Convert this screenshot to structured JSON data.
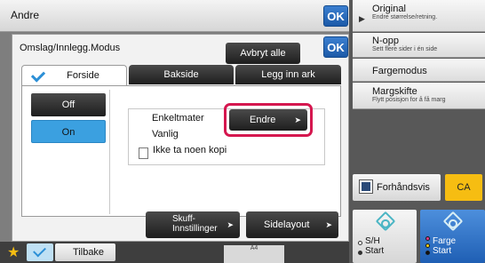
{
  "top_bar": {
    "title": "Andre",
    "ok_label": "OK"
  },
  "dialog": {
    "title": "Omslag/Innlegg.Modus",
    "cancel_all_label": "Avbryt alle",
    "ok_label": "OK",
    "tabs": [
      {
        "label": "Forside",
        "selected": true
      },
      {
        "label": "Bakside",
        "selected": false
      },
      {
        "label": "Legg inn ark",
        "selected": false
      }
    ],
    "toggle": {
      "off_label": "Off",
      "on_label": "On",
      "value": "On"
    },
    "info_lines": [
      "Enkeltmater",
      "Vanlig",
      "Ikke ta noen kopi"
    ],
    "change_button_label": "Endre",
    "tray_settings_label_1": "Skuff-",
    "tray_settings_label_2": "Innstillinger",
    "page_layout_label": "Sidelayout"
  },
  "right_panel": {
    "items": [
      {
        "title": "Original",
        "subtitle": "Endre størrelse/retning."
      },
      {
        "title": "N-opp",
        "subtitle": "Sett flere sider i én side"
      },
      {
        "title": "Fargemodus",
        "subtitle": ""
      },
      {
        "title": "Margskifte",
        "subtitle": "Flytt posisjon for å få marg"
      }
    ],
    "preview_label": "Forhåndsvis",
    "ca_label": "CA",
    "bw_start_line1": "S/H",
    "bw_start_line2": "Start",
    "color_start_line1": "Farge",
    "color_start_line2": "Start"
  },
  "bottom_bar": {
    "back_label": "Tilbake",
    "preview_art_text": "A4"
  },
  "colors": {
    "accent_blue": "#1c5aa8",
    "highlight_red": "#d5174f",
    "ca_yellow": "#f6bd12",
    "on_blue": "#3ba0e0"
  }
}
